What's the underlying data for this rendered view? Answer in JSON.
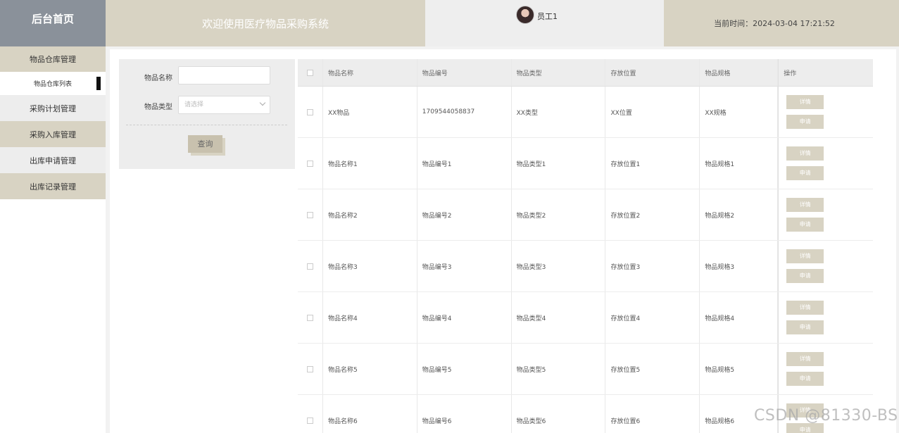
{
  "header": {
    "brand": "后台首页",
    "welcome": "欢迎使用医疗物品采购系统",
    "username": "员工1",
    "time_label": "当前时间：",
    "time_value": "2024-03-04 17:21:52"
  },
  "sidebar": {
    "items": [
      {
        "label": "物品仓库管理"
      },
      {
        "label": "物品仓库列表"
      },
      {
        "label": "采购计划管理"
      },
      {
        "label": "采购入库管理"
      },
      {
        "label": "出库申请管理"
      },
      {
        "label": "出库记录管理"
      }
    ]
  },
  "search": {
    "name_label": "物品名称",
    "type_label": "物品类型",
    "type_placeholder": "请选择",
    "query_button": "查询"
  },
  "table": {
    "headers": [
      "物品名称",
      "物品编号",
      "物品类型",
      "存放位置",
      "物品规格",
      "操作"
    ],
    "rows": [
      [
        "XX物品",
        "1709544058837",
        "XX类型",
        "XX位置",
        "XX规格"
      ],
      [
        "物品名称1",
        "物品编号1",
        "物品类型1",
        "存放位置1",
        "物品规格1"
      ],
      [
        "物品名称2",
        "物品编号2",
        "物品类型2",
        "存放位置2",
        "物品规格2"
      ],
      [
        "物品名称3",
        "物品编号3",
        "物品类型3",
        "存放位置3",
        "物品规格3"
      ],
      [
        "物品名称4",
        "物品编号4",
        "物品类型4",
        "存放位置4",
        "物品规格4"
      ],
      [
        "物品名称5",
        "物品编号5",
        "物品类型5",
        "存放位置5",
        "物品规格5"
      ],
      [
        "物品名称6",
        "物品编号6",
        "物品类型6",
        "存放位置6",
        "物品规格6"
      ]
    ],
    "detail_button": "详情",
    "apply_button": "申请"
  },
  "watermark": "CSDN @81330-BS"
}
